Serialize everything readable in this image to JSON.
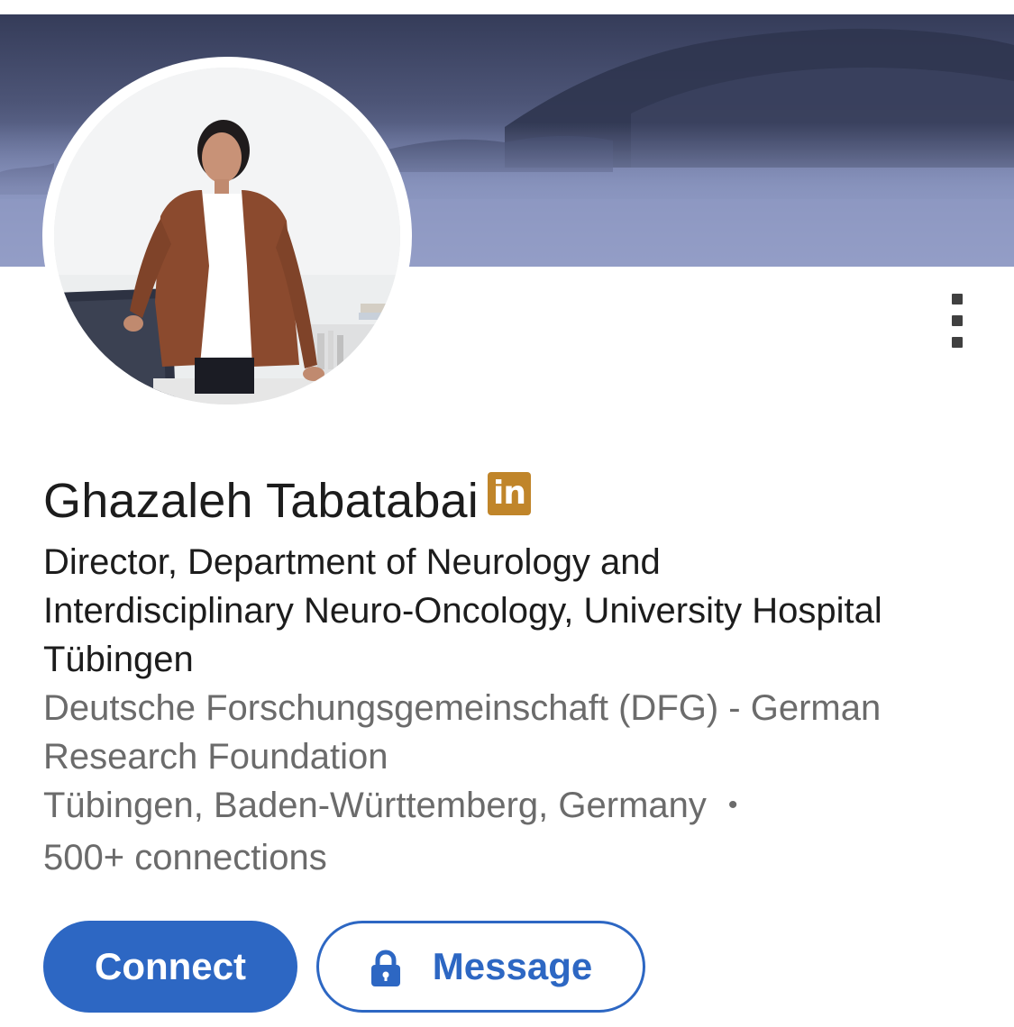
{
  "profile": {
    "name": "Ghazaleh Tabatabai",
    "badge_text": "in",
    "headline": "Director, Department of Neurology and Interdisciplinary Neuro-Oncology, University Hospital Tübingen",
    "company": "Deutsche Forschungsgemeinschaft (DFG) - German Research Foundation",
    "location": "Tübingen, Baden-Württemberg, Germany",
    "separator": "•",
    "connections": "500+ connections"
  },
  "actions": {
    "connect_label": "Connect",
    "message_label": "Message"
  },
  "icons": {
    "more": "vertical-dots-icon",
    "lock": "lock-icon",
    "badge": "linkedin-badge-icon"
  },
  "colors": {
    "accent": "#2d67c3",
    "badge": "#c0852a",
    "primary_text": "#1c1c1c",
    "secondary_text": "#6b6b6b"
  }
}
